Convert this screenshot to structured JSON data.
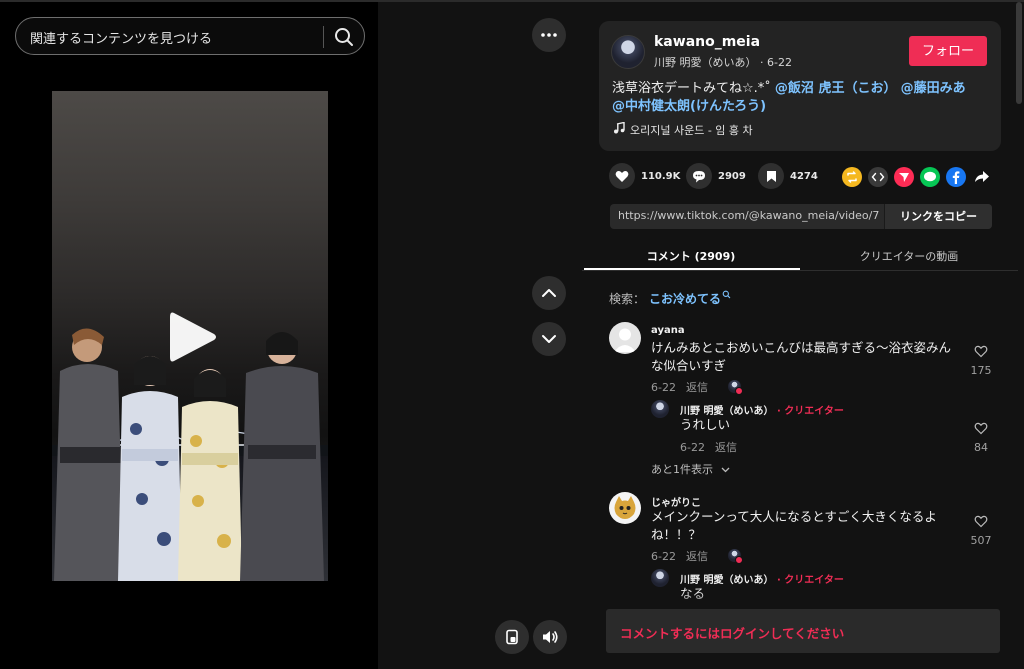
{
  "search": {
    "placeholder": "関連するコンテンツを見つける"
  },
  "author": {
    "username": "kawano_meia",
    "display_name": "川野 明愛（めいあ）",
    "date": "6-22",
    "follow_label": "フォロー"
  },
  "caption": {
    "text": "浅草浴衣デートみてね☆.*˚ ",
    "tags": [
      "@飯沼 虎王（こお）",
      "@藤田みあ",
      "@中村健太朗(けんたろう)"
    ]
  },
  "sound": {
    "title": "오리지널 사운드 - 임 홍 차"
  },
  "stats": {
    "likes": "110.9K",
    "comments": "2909",
    "saves": "4274"
  },
  "link": {
    "url": "https://www.tiktok.com/@kawano_meia/video/75...",
    "copy_label": "リンクをコピー"
  },
  "tabs": {
    "comments": "コメント (2909)",
    "creator_videos": "クリエイターの動画"
  },
  "search_suggest": {
    "label": "検索：",
    "keyword": "こお冷めてる"
  },
  "comments": [
    {
      "name": "ayana",
      "text": "けんみあとこおめいこんびは最高すぎる〜浴衣姿みんな似合いすぎ",
      "date": "6-22",
      "reply_label": "返信",
      "likes": "175",
      "reply": {
        "name": "川野 明愛（めいあ）",
        "creator_label": "· クリエイター",
        "text": "うれしい",
        "date": "6-22",
        "reply_label": "返信",
        "likes": "84"
      },
      "more_replies": "あと1件表示"
    },
    {
      "name": "じゃがりこ",
      "text": "メインクーンって大人になるとすごく大きくなるよね！！？",
      "date": "6-22",
      "reply_label": "返信",
      "likes": "507",
      "reply": {
        "name": "川野 明愛（めいあ）",
        "creator_label": "· クリエイター",
        "text": "なる"
      }
    }
  ],
  "login_prompt": "コメントするにはログインしてください",
  "colors": {
    "accent": "#ef2d55",
    "link": "#7ec3ff",
    "panel": "#121212",
    "card": "#232323"
  }
}
